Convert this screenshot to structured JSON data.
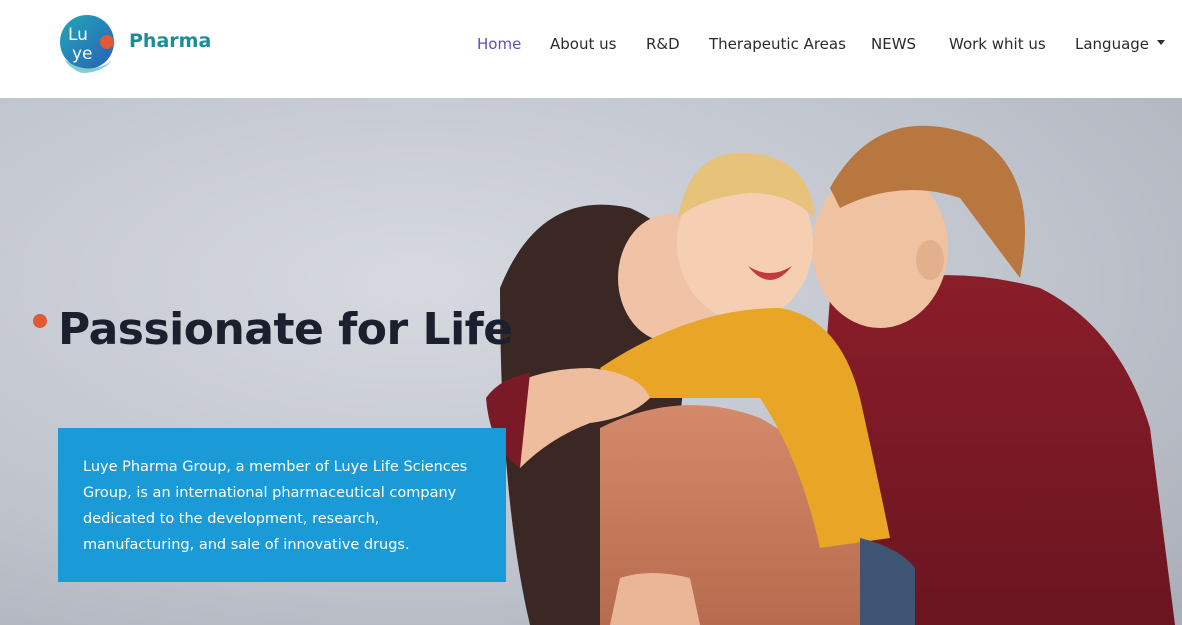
{
  "brand": {
    "logo_text_top": "Lu",
    "logo_text_bottom": "ye",
    "name": "Pharma",
    "colors": {
      "teal": "#1c8c9b",
      "accent": "#e05a35",
      "blue": "#1a9bd7"
    }
  },
  "nav": {
    "items": [
      {
        "label": "Home",
        "active": true
      },
      {
        "label": "About us"
      },
      {
        "label": "R&D"
      },
      {
        "label": "Therapeutic Areas"
      },
      {
        "label": "NEWS"
      },
      {
        "label": "Work whit us"
      },
      {
        "label": "Language",
        "icon": "caret-down-icon"
      }
    ]
  },
  "hero": {
    "title": "Passionate for Life",
    "description": "Luye Pharma Group, a member of Luye Life Sciences Group, is an international pharmaceutical company dedicated to the development, research, manufacturing, and sale of innovative drugs.",
    "image_alt": "family-hug-photo"
  }
}
